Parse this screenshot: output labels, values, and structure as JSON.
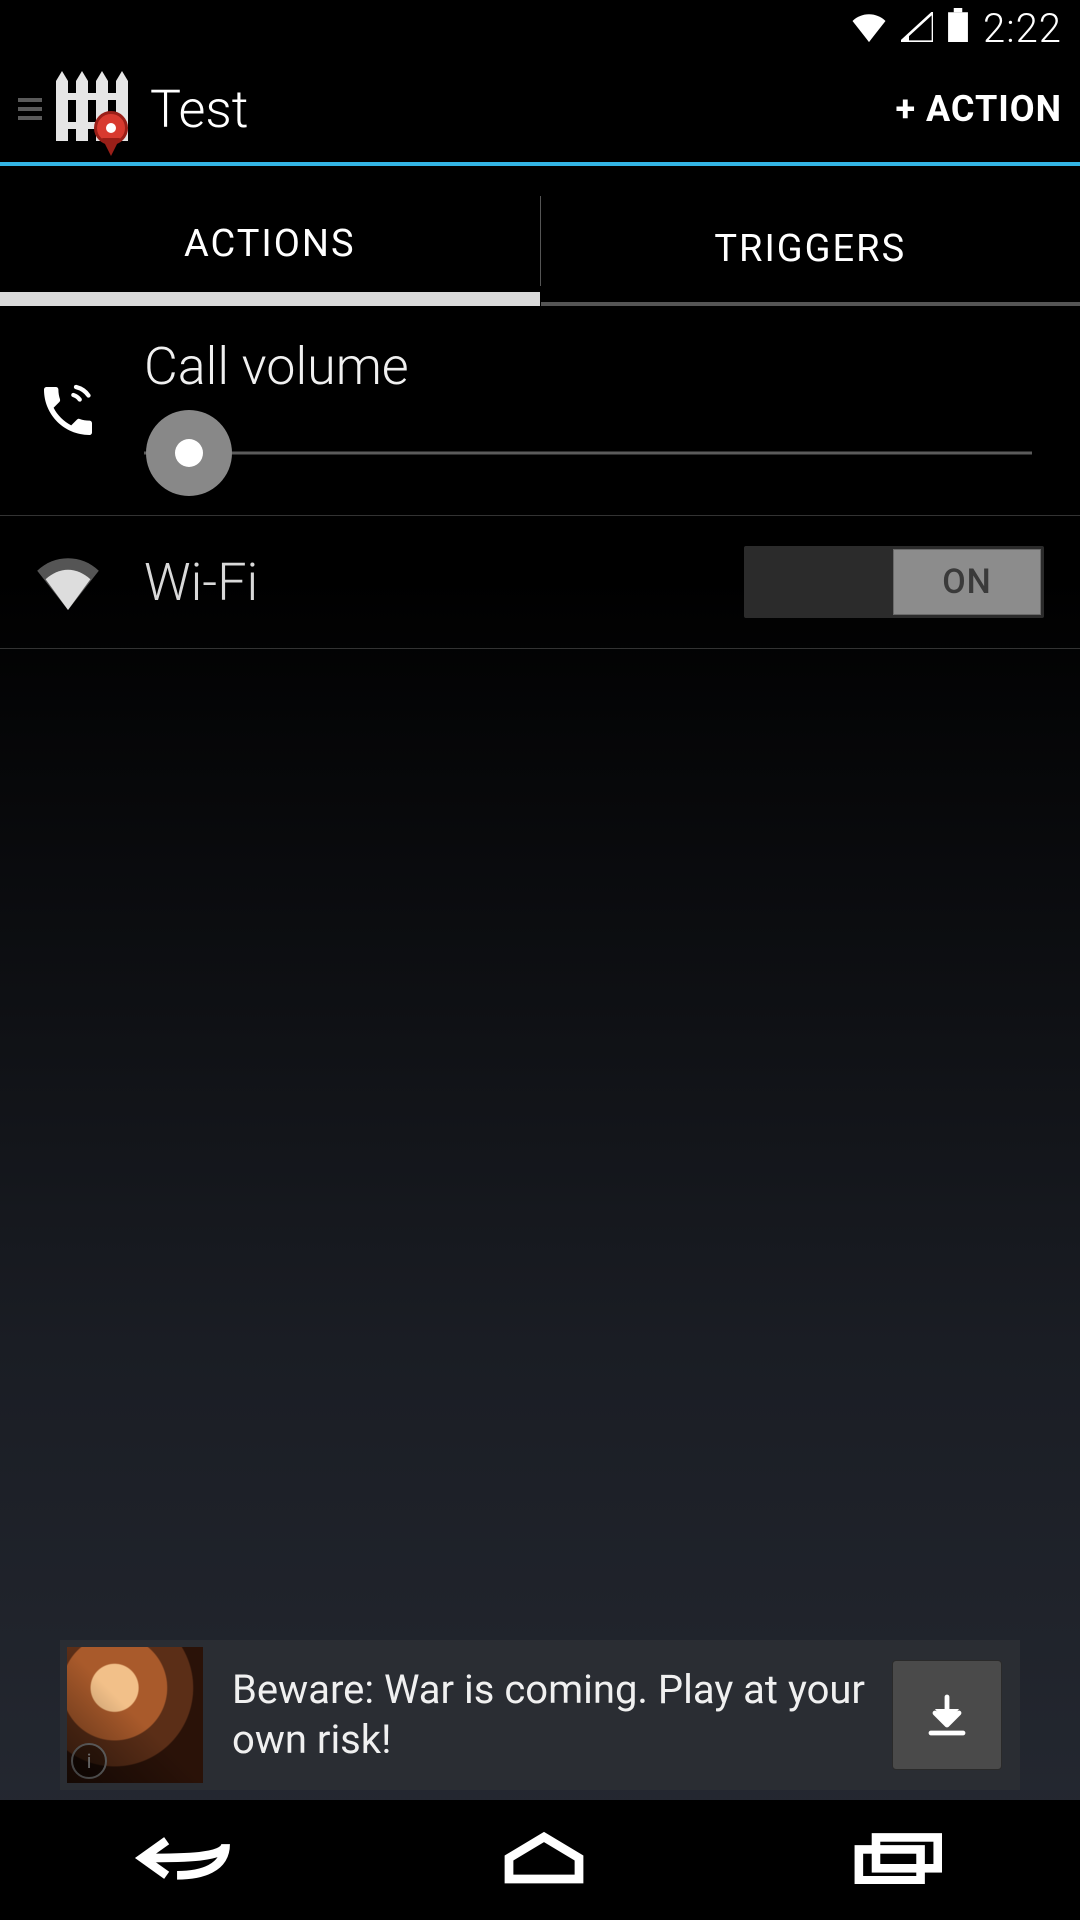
{
  "status": {
    "time": "2:22"
  },
  "header": {
    "title": "Test",
    "action": "+ ACTION"
  },
  "tabs": {
    "actions": "ACTIONS",
    "triggers": "TRIGGERS",
    "active": "actions"
  },
  "actions": {
    "call_volume": {
      "label": "Call volume",
      "value_percent": 5
    },
    "wifi": {
      "label": "Wi-Fi",
      "state_label": "ON",
      "state": true
    }
  },
  "ad": {
    "text": "Beware: War is coming. Play at your own risk!"
  }
}
